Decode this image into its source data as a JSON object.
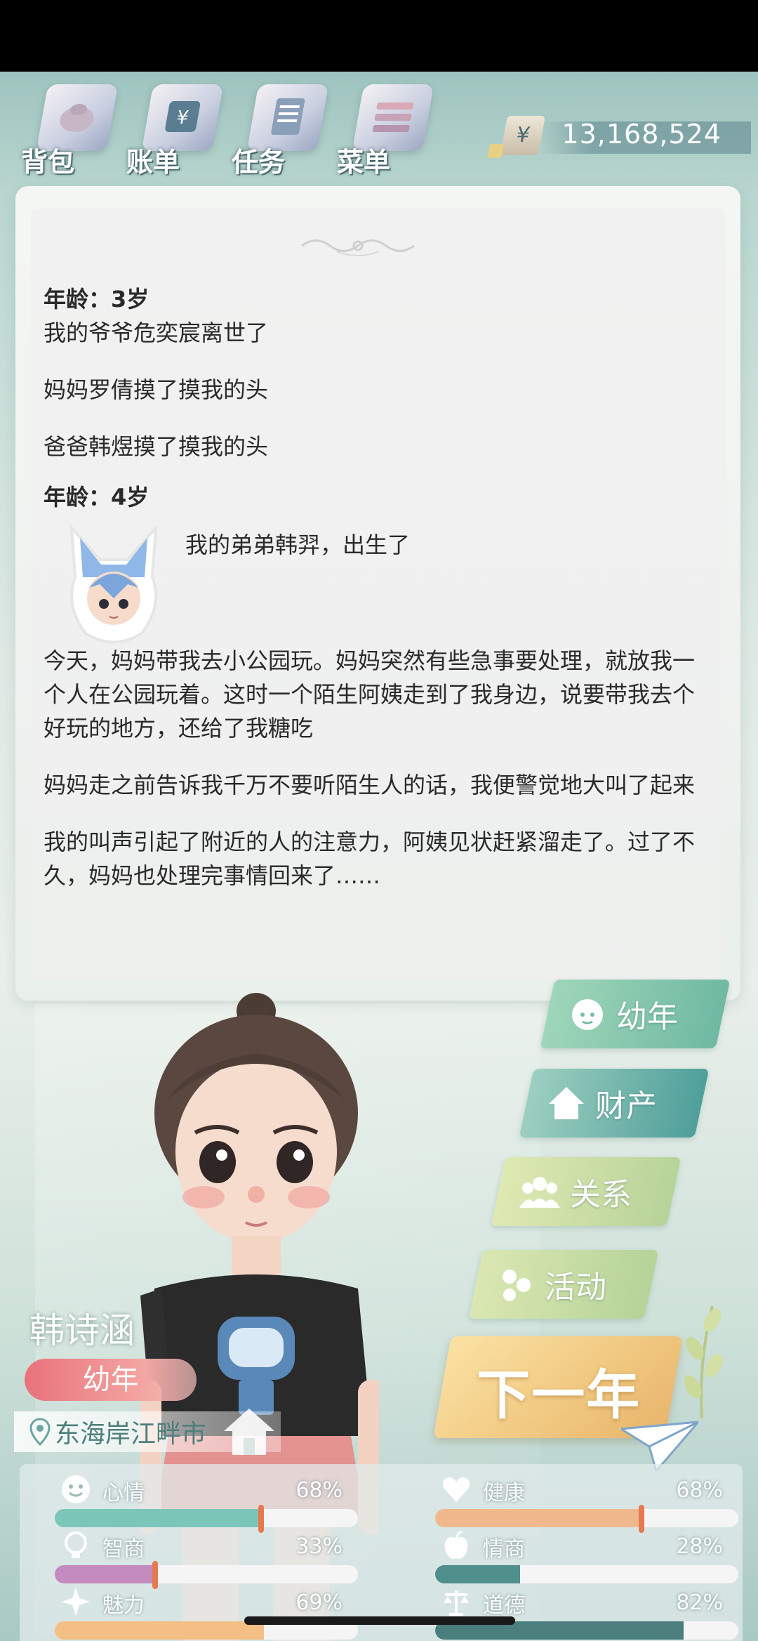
{
  "nav": {
    "items": [
      {
        "label": "背包",
        "icon": "backpack-icon"
      },
      {
        "label": "账单",
        "icon": "bill-icon"
      },
      {
        "label": "任务",
        "icon": "task-icon"
      },
      {
        "label": "菜单",
        "icon": "menu-icon"
      }
    ]
  },
  "money": {
    "symbol": "¥",
    "value": "13,168,524"
  },
  "diary": {
    "age3": {
      "title": "年龄：3岁",
      "lines": [
        "我的爷爷危奕宸离世了",
        "妈妈罗倩摸了摸我的头",
        "爸爸韩煜摸了摸我的头"
      ]
    },
    "age4": {
      "title": "年龄：4岁",
      "birth": "我的弟弟韩羿，出生了",
      "paragraphs": [
        "今天，妈妈带我去小公园玩。妈妈突然有些急事要处理，就放我一个人在公园玩着。这时一个陌生阿姨走到了我身边，说要带我去个好玩的地方，还给了我糖吃",
        "妈妈走之前告诉我千万不要听陌生人的话，我便警觉地大叫了起来",
        "我的叫声引起了附近的人的注意力，阿姨见状赶紧溜走了。过了不久，妈妈也处理完事情回来了……"
      ]
    }
  },
  "menu": {
    "age_stage": "幼年",
    "assets": "财产",
    "relations": "关系",
    "activities": "活动",
    "next_year": "下一年"
  },
  "character": {
    "name": "韩诗涵",
    "stage": "幼年",
    "location": "东海岸江畔市"
  },
  "stats": [
    {
      "name": "心情",
      "percent": "68%",
      "value": 0.68,
      "color": "#7cc6b9"
    },
    {
      "name": "健康",
      "percent": "68%",
      "value": 0.68,
      "color": "#f0b98d"
    },
    {
      "name": "智商",
      "percent": "33%",
      "value": 0.33,
      "color": "#c48bc0"
    },
    {
      "name": "情商",
      "percent": "28%",
      "value": 0.28,
      "color": "#4f8f8c"
    },
    {
      "name": "魅力",
      "percent": "69%",
      "value": 0.69,
      "color": "#f3bf85"
    },
    {
      "name": "道德",
      "percent": "82%",
      "value": 0.82,
      "color": "#4a7f7d"
    }
  ]
}
